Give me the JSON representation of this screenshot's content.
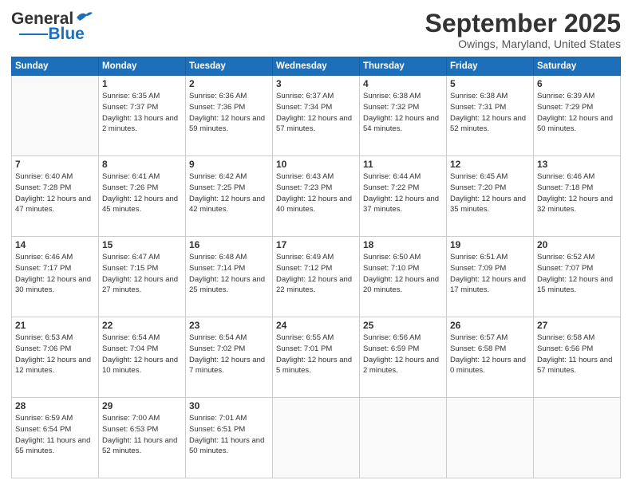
{
  "header": {
    "logo_line1": "General",
    "logo_line2": "Blue",
    "title": "September 2025",
    "subtitle": "Owings, Maryland, United States"
  },
  "days_of_week": [
    "Sunday",
    "Monday",
    "Tuesday",
    "Wednesday",
    "Thursday",
    "Friday",
    "Saturday"
  ],
  "weeks": [
    [
      {
        "num": "",
        "sunrise": "",
        "sunset": "",
        "daylight": ""
      },
      {
        "num": "1",
        "sunrise": "Sunrise: 6:35 AM",
        "sunset": "Sunset: 7:37 PM",
        "daylight": "Daylight: 13 hours and 2 minutes."
      },
      {
        "num": "2",
        "sunrise": "Sunrise: 6:36 AM",
        "sunset": "Sunset: 7:36 PM",
        "daylight": "Daylight: 12 hours and 59 minutes."
      },
      {
        "num": "3",
        "sunrise": "Sunrise: 6:37 AM",
        "sunset": "Sunset: 7:34 PM",
        "daylight": "Daylight: 12 hours and 57 minutes."
      },
      {
        "num": "4",
        "sunrise": "Sunrise: 6:38 AM",
        "sunset": "Sunset: 7:32 PM",
        "daylight": "Daylight: 12 hours and 54 minutes."
      },
      {
        "num": "5",
        "sunrise": "Sunrise: 6:38 AM",
        "sunset": "Sunset: 7:31 PM",
        "daylight": "Daylight: 12 hours and 52 minutes."
      },
      {
        "num": "6",
        "sunrise": "Sunrise: 6:39 AM",
        "sunset": "Sunset: 7:29 PM",
        "daylight": "Daylight: 12 hours and 50 minutes."
      }
    ],
    [
      {
        "num": "7",
        "sunrise": "Sunrise: 6:40 AM",
        "sunset": "Sunset: 7:28 PM",
        "daylight": "Daylight: 12 hours and 47 minutes."
      },
      {
        "num": "8",
        "sunrise": "Sunrise: 6:41 AM",
        "sunset": "Sunset: 7:26 PM",
        "daylight": "Daylight: 12 hours and 45 minutes."
      },
      {
        "num": "9",
        "sunrise": "Sunrise: 6:42 AM",
        "sunset": "Sunset: 7:25 PM",
        "daylight": "Daylight: 12 hours and 42 minutes."
      },
      {
        "num": "10",
        "sunrise": "Sunrise: 6:43 AM",
        "sunset": "Sunset: 7:23 PM",
        "daylight": "Daylight: 12 hours and 40 minutes."
      },
      {
        "num": "11",
        "sunrise": "Sunrise: 6:44 AM",
        "sunset": "Sunset: 7:22 PM",
        "daylight": "Daylight: 12 hours and 37 minutes."
      },
      {
        "num": "12",
        "sunrise": "Sunrise: 6:45 AM",
        "sunset": "Sunset: 7:20 PM",
        "daylight": "Daylight: 12 hours and 35 minutes."
      },
      {
        "num": "13",
        "sunrise": "Sunrise: 6:46 AM",
        "sunset": "Sunset: 7:18 PM",
        "daylight": "Daylight: 12 hours and 32 minutes."
      }
    ],
    [
      {
        "num": "14",
        "sunrise": "Sunrise: 6:46 AM",
        "sunset": "Sunset: 7:17 PM",
        "daylight": "Daylight: 12 hours and 30 minutes."
      },
      {
        "num": "15",
        "sunrise": "Sunrise: 6:47 AM",
        "sunset": "Sunset: 7:15 PM",
        "daylight": "Daylight: 12 hours and 27 minutes."
      },
      {
        "num": "16",
        "sunrise": "Sunrise: 6:48 AM",
        "sunset": "Sunset: 7:14 PM",
        "daylight": "Daylight: 12 hours and 25 minutes."
      },
      {
        "num": "17",
        "sunrise": "Sunrise: 6:49 AM",
        "sunset": "Sunset: 7:12 PM",
        "daylight": "Daylight: 12 hours and 22 minutes."
      },
      {
        "num": "18",
        "sunrise": "Sunrise: 6:50 AM",
        "sunset": "Sunset: 7:10 PM",
        "daylight": "Daylight: 12 hours and 20 minutes."
      },
      {
        "num": "19",
        "sunrise": "Sunrise: 6:51 AM",
        "sunset": "Sunset: 7:09 PM",
        "daylight": "Daylight: 12 hours and 17 minutes."
      },
      {
        "num": "20",
        "sunrise": "Sunrise: 6:52 AM",
        "sunset": "Sunset: 7:07 PM",
        "daylight": "Daylight: 12 hours and 15 minutes."
      }
    ],
    [
      {
        "num": "21",
        "sunrise": "Sunrise: 6:53 AM",
        "sunset": "Sunset: 7:06 PM",
        "daylight": "Daylight: 12 hours and 12 minutes."
      },
      {
        "num": "22",
        "sunrise": "Sunrise: 6:54 AM",
        "sunset": "Sunset: 7:04 PM",
        "daylight": "Daylight: 12 hours and 10 minutes."
      },
      {
        "num": "23",
        "sunrise": "Sunrise: 6:54 AM",
        "sunset": "Sunset: 7:02 PM",
        "daylight": "Daylight: 12 hours and 7 minutes."
      },
      {
        "num": "24",
        "sunrise": "Sunrise: 6:55 AM",
        "sunset": "Sunset: 7:01 PM",
        "daylight": "Daylight: 12 hours and 5 minutes."
      },
      {
        "num": "25",
        "sunrise": "Sunrise: 6:56 AM",
        "sunset": "Sunset: 6:59 PM",
        "daylight": "Daylight: 12 hours and 2 minutes."
      },
      {
        "num": "26",
        "sunrise": "Sunrise: 6:57 AM",
        "sunset": "Sunset: 6:58 PM",
        "daylight": "Daylight: 12 hours and 0 minutes."
      },
      {
        "num": "27",
        "sunrise": "Sunrise: 6:58 AM",
        "sunset": "Sunset: 6:56 PM",
        "daylight": "Daylight: 11 hours and 57 minutes."
      }
    ],
    [
      {
        "num": "28",
        "sunrise": "Sunrise: 6:59 AM",
        "sunset": "Sunset: 6:54 PM",
        "daylight": "Daylight: 11 hours and 55 minutes."
      },
      {
        "num": "29",
        "sunrise": "Sunrise: 7:00 AM",
        "sunset": "Sunset: 6:53 PM",
        "daylight": "Daylight: 11 hours and 52 minutes."
      },
      {
        "num": "30",
        "sunrise": "Sunrise: 7:01 AM",
        "sunset": "Sunset: 6:51 PM",
        "daylight": "Daylight: 11 hours and 50 minutes."
      },
      {
        "num": "",
        "sunrise": "",
        "sunset": "",
        "daylight": ""
      },
      {
        "num": "",
        "sunrise": "",
        "sunset": "",
        "daylight": ""
      },
      {
        "num": "",
        "sunrise": "",
        "sunset": "",
        "daylight": ""
      },
      {
        "num": "",
        "sunrise": "",
        "sunset": "",
        "daylight": ""
      }
    ]
  ]
}
